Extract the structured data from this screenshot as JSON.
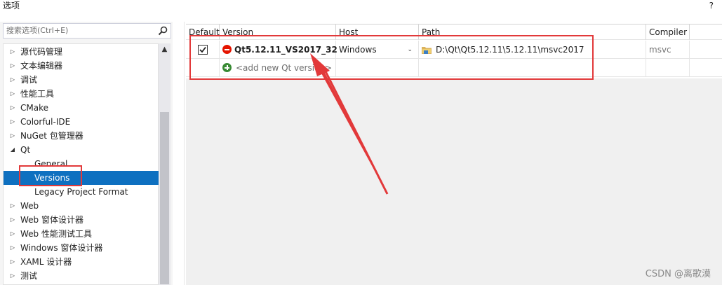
{
  "window": {
    "title": "选项",
    "help_label": "?"
  },
  "search": {
    "placeholder": "搜索选项(Ctrl+E)",
    "icon": "search-icon"
  },
  "tree": {
    "items": [
      {
        "label": "源代码管理",
        "expanded": false
      },
      {
        "label": "文本编辑器",
        "expanded": false
      },
      {
        "label": "调试",
        "expanded": false
      },
      {
        "label": "性能工具",
        "expanded": false
      },
      {
        "label": "CMake",
        "expanded": false
      },
      {
        "label": "Colorful-IDE",
        "expanded": false
      },
      {
        "label": "NuGet 包管理器",
        "expanded": false
      },
      {
        "label": "Qt",
        "expanded": true,
        "children": [
          {
            "label": "General",
            "selected": false
          },
          {
            "label": "Versions",
            "selected": true
          },
          {
            "label": "Legacy Project Format",
            "selected": false
          }
        ]
      },
      {
        "label": "Web",
        "expanded": false
      },
      {
        "label": "Web 窗体设计器",
        "expanded": false
      },
      {
        "label": "Web 性能测试工具",
        "expanded": false
      },
      {
        "label": "Windows 窗体设计器",
        "expanded": false
      },
      {
        "label": "XAML 设计器",
        "expanded": false
      },
      {
        "label": "测试",
        "expanded": false
      }
    ]
  },
  "grid": {
    "columns": [
      "Default",
      "Version",
      "Host",
      "Path",
      "Compiler"
    ],
    "rows": [
      {
        "default_checked": true,
        "version": "Qt5.12.11_VS2017_32",
        "host": "Windows",
        "path": "D:\\Qt\\Qt5.12.11\\5.12.11\\msvc2017",
        "compiler": "msvc"
      }
    ],
    "add_row_label": "<add new Qt version>"
  },
  "colors": {
    "accent": "#0e70c0",
    "highlight": "#e2393a",
    "error": "#e51400",
    "add": "#388a34"
  },
  "watermark": "CSDN @离歌漠"
}
